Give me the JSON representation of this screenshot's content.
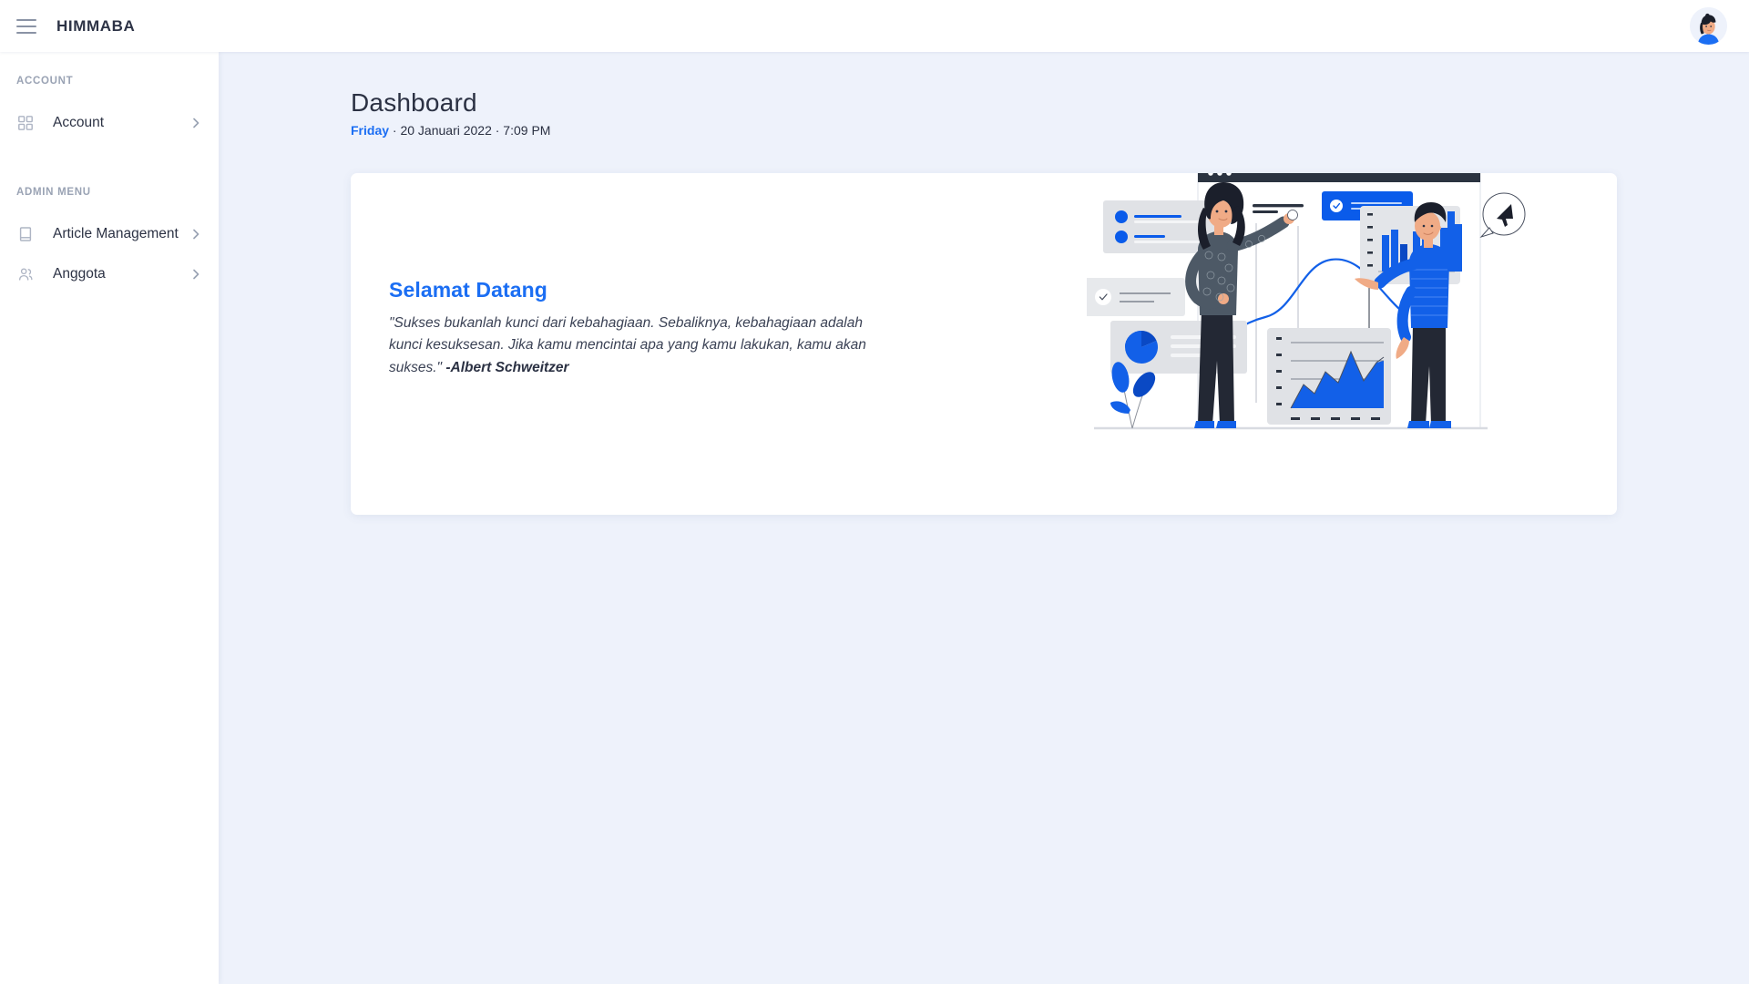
{
  "header": {
    "menu_icon": "hamburger-icon",
    "brand": "HIMMABA",
    "avatar_icon": "user-avatar"
  },
  "sidebar": {
    "sections": [
      {
        "title": "ACCOUNT",
        "items": [
          {
            "label": "Account",
            "icon": "grid-icon",
            "chevron": "chevron-right-icon"
          }
        ]
      },
      {
        "title": "ADMIN MENU",
        "items": [
          {
            "label": "Article Management",
            "icon": "book-icon",
            "chevron": "chevron-right-icon"
          },
          {
            "label": "Anggota",
            "icon": "users-icon",
            "chevron": "chevron-right-icon"
          }
        ]
      }
    ]
  },
  "main": {
    "title": "Dashboard",
    "date": {
      "day": "Friday",
      "rest": " · 20 Januari 2022 · 7:09 PM"
    },
    "card": {
      "welcome": "Selamat Datang",
      "quote": "\"Sukses bukanlah kunci dari kebahagiaan. Sebaliknya, kebahagiaan adalah kunci kesuksesan. Jika kamu mencintai apa yang kamu lakukan, kamu akan sukses.\" ",
      "author": "-Albert Schweitzer",
      "illustration": "dashboard-analytics-illustration"
    }
  },
  "colors": {
    "accent_blue": "#1b6ef3",
    "deep_blue": "#0a49c4",
    "dark": "#2b3143",
    "page_bg": "#eef2fb",
    "card_bg": "#ffffff",
    "muted": "#9aa3b4"
  }
}
